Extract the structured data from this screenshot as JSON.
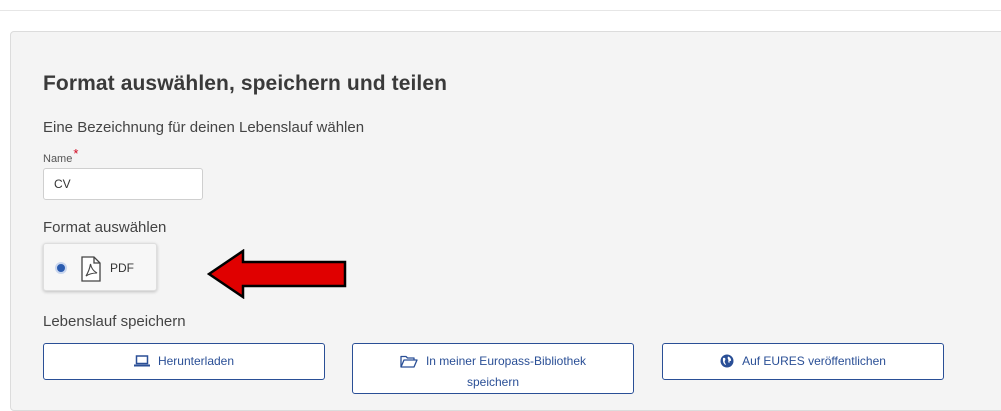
{
  "section": {
    "title": "Format auswählen, speichern und teilen",
    "subtitle": "Eine Bezeichnung für deinen Lebenslauf wählen"
  },
  "name_field": {
    "label": "Name",
    "required_marker": "*",
    "value": "CV"
  },
  "format": {
    "heading": "Format auswählen",
    "options": [
      {
        "label": "PDF",
        "icon": "pdf-file-icon",
        "selected": true
      }
    ]
  },
  "annotation": {
    "icon": "red-arrow-icon",
    "color": "#e00000"
  },
  "save": {
    "heading": "Lebenslauf speichern",
    "buttons": [
      {
        "label": "Herunterladen",
        "icon": "laptop-icon"
      },
      {
        "label_line1": "In meiner Europass-Bibliothek",
        "label_line2": "speichern",
        "icon": "folder-open-icon"
      },
      {
        "label": "Auf EURES veröffentlichen",
        "icon": "globe-icon"
      }
    ]
  },
  "colors": {
    "accent": "#2a4f96",
    "panel_background": "#f4f4f4",
    "required": "#d0021b"
  }
}
